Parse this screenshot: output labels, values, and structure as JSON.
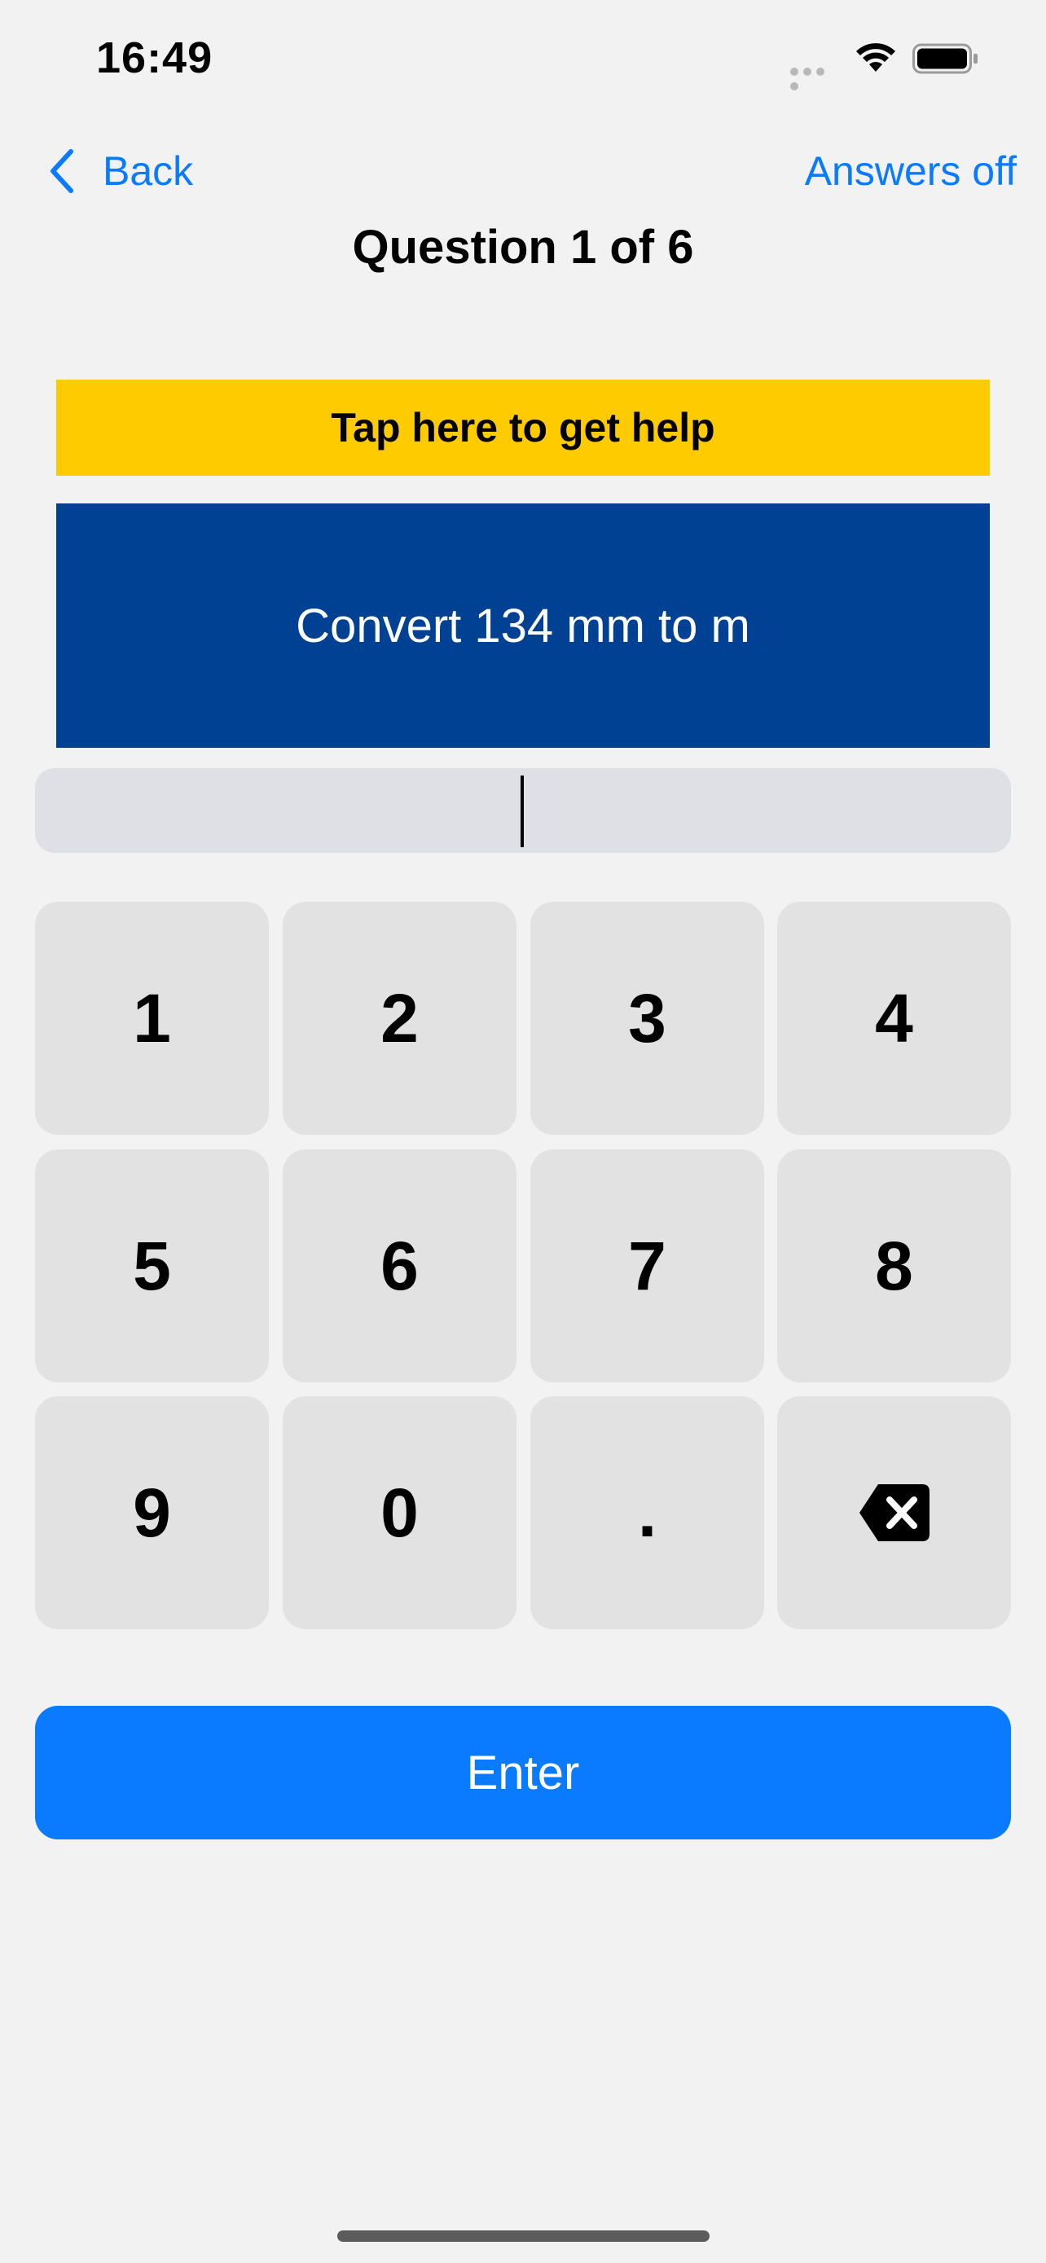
{
  "status_bar": {
    "time": "16:49"
  },
  "nav": {
    "back_label": "Back",
    "answers_label": "Answers off",
    "title": "Question 1 of 6"
  },
  "help": {
    "label": "Tap here to get help",
    "color": "#fecb00"
  },
  "question": {
    "text": "Convert 134 mm to m",
    "color": "#004193"
  },
  "answer_input": {
    "value": ""
  },
  "keypad": {
    "keys": [
      "1",
      "2",
      "3",
      "4",
      "5",
      "6",
      "7",
      "8",
      "9",
      "0",
      "."
    ],
    "delete_icon": "delete-backspace-icon"
  },
  "enter": {
    "label": "Enter",
    "color": "#0a7aff"
  }
}
